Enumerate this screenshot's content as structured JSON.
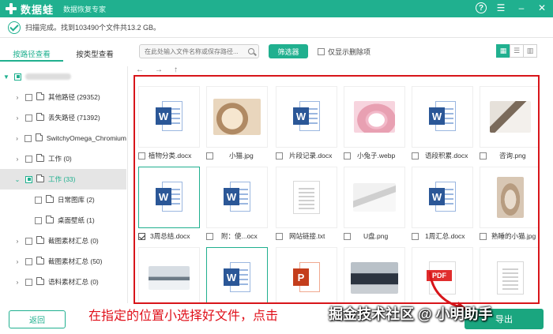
{
  "app": {
    "brand": "数据蛙",
    "subtitle": "数据恢复专家"
  },
  "status": {
    "text": "扫描完成。找到103490个文件共13.2 GB。"
  },
  "tabs": [
    {
      "label": "按路径查看",
      "active": true
    },
    {
      "label": "按类型查看",
      "active": false
    }
  ],
  "toolbar": {
    "search_placeholder": "在此处输入文件名称或保存路径...",
    "filter_label": "筛选器",
    "only_deleted_label": "仅显示删除项"
  },
  "tree": [
    {
      "label": "其他路径 (29352)"
    },
    {
      "label": "丢失路径 (71392)"
    },
    {
      "label": "SwitchyOmega_Chromium"
    },
    {
      "label": "工作 (0)"
    },
    {
      "label": "工作 (33)"
    },
    {
      "label": "日常图库 (2)"
    },
    {
      "label": "桌面壁纸 (1)"
    },
    {
      "label": "截图素材汇总 (0)"
    },
    {
      "label": "截图素材汇总 (50)"
    },
    {
      "label": "语料素材汇总 (0)"
    }
  ],
  "files": [
    {
      "name": "植物分类.docx",
      "kind": "word"
    },
    {
      "name": "小猫.jpg",
      "kind": "photo-cat"
    },
    {
      "name": "片段记录.docx",
      "kind": "word"
    },
    {
      "name": "小兔子.webp",
      "kind": "photo-rabbit"
    },
    {
      "name": "语段积累.docx",
      "kind": "word"
    },
    {
      "name": "咨询.png",
      "kind": "photo-meeting"
    },
    {
      "name": "3周总结.docx",
      "kind": "word"
    },
    {
      "name": "附：使...ocx",
      "kind": "word"
    },
    {
      "name": "网站链接.txt",
      "kind": "txt"
    },
    {
      "name": "U盘.png",
      "kind": "photo-usb"
    },
    {
      "name": "1周汇总.docx",
      "kind": "word"
    },
    {
      "name": "熟睡的小猫.jpg",
      "kind": "photo-kitten"
    }
  ],
  "icons": {
    "word_badge": "W",
    "ppt_badge": "P",
    "pdf_badge": "PDF"
  },
  "buttons": {
    "back": "返回",
    "next": "导出"
  },
  "overlay": {
    "instruction": "在指定的位置小选择好文件，点击",
    "watermark": "掘金技术社区 @ 小明助手"
  },
  "colors": {
    "brand": "#20b08f",
    "annotation_red": "#d8151a"
  }
}
